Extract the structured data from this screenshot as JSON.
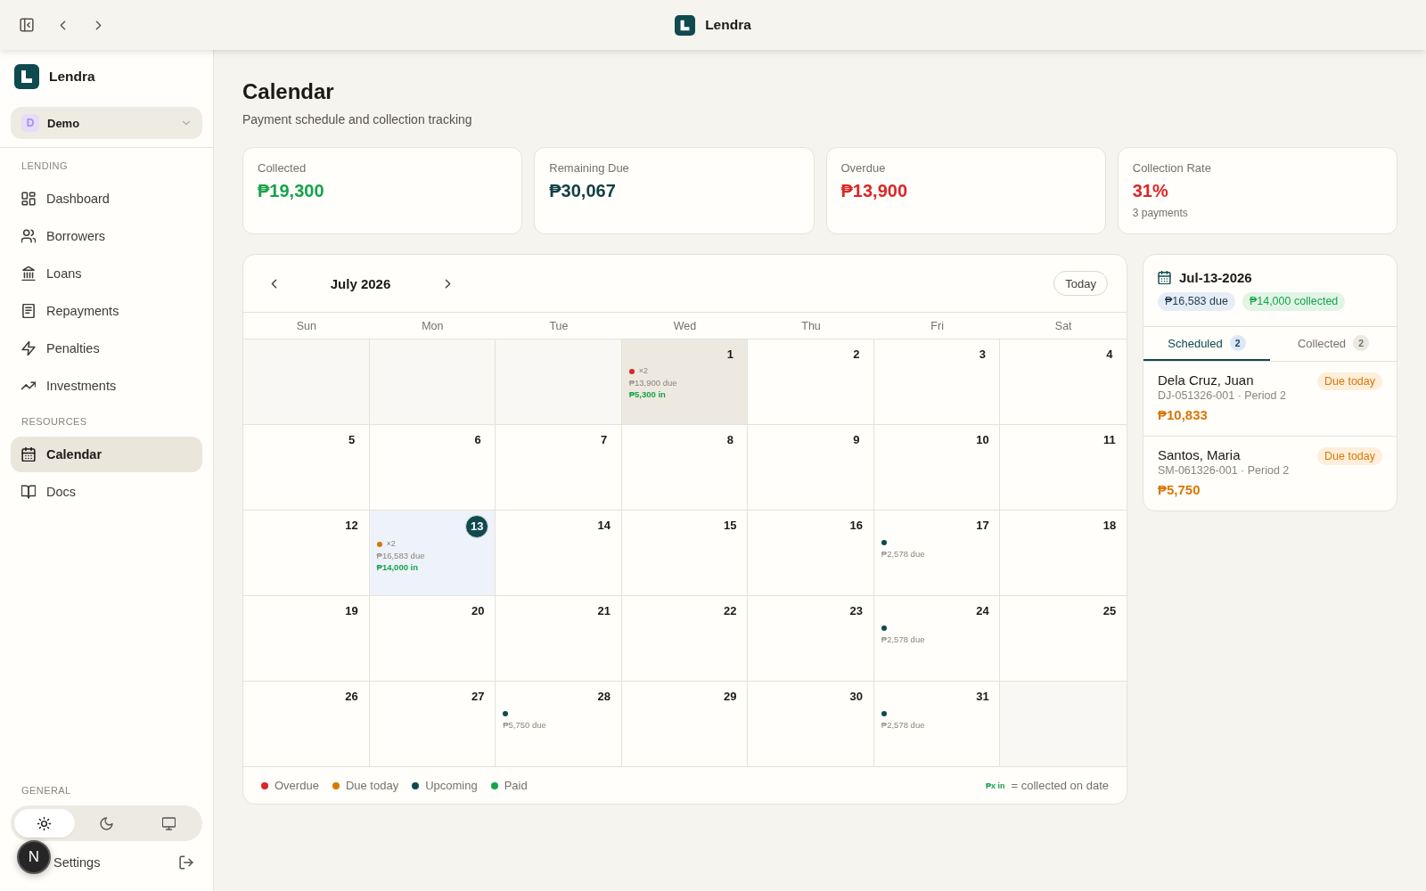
{
  "topbar": {
    "app_name": "Lendra"
  },
  "sidebar": {
    "brand": "Lendra",
    "workspace": {
      "initial": "D",
      "name": "Demo"
    },
    "sections": [
      {
        "title": "LENDING",
        "items": [
          {
            "kind": "dashboard",
            "label": "Dashboard",
            "selected": false
          },
          {
            "kind": "borrowers",
            "label": "Borrowers",
            "selected": false
          },
          {
            "kind": "loans",
            "label": "Loans",
            "selected": false
          },
          {
            "kind": "repayments",
            "label": "Repayments",
            "selected": false
          },
          {
            "kind": "penalties",
            "label": "Penalties",
            "selected": false
          },
          {
            "kind": "investments",
            "label": "Investments",
            "selected": false
          }
        ]
      },
      {
        "title": "RESOURCES",
        "items": [
          {
            "kind": "calendar",
            "label": "Calendar",
            "selected": true
          },
          {
            "kind": "docs",
            "label": "Docs",
            "selected": false
          }
        ]
      }
    ],
    "general": {
      "title": "GENERAL",
      "theme": [
        {
          "kind": "light",
          "selected": true
        },
        {
          "kind": "dark",
          "selected": false
        },
        {
          "kind": "system",
          "selected": false
        }
      ],
      "settings": "Settings"
    }
  },
  "dev_badge": {
    "label": "N"
  },
  "page": {
    "title": "Calendar",
    "subtitle": "Payment schedule and collection tracking"
  },
  "stats": [
    {
      "label": "Collected",
      "value": "₱19,300",
      "color": "#16a34a"
    },
    {
      "label": "Remaining Due",
      "value": "₱30,067",
      "color": "#113f45"
    },
    {
      "label": "Overdue",
      "value": "₱13,900",
      "color": "#dc2626"
    },
    {
      "label": "Collection Rate",
      "value": "31%",
      "color": "#dc2626",
      "note": "3 payments"
    }
  ],
  "calendar": {
    "month": "July 2026",
    "today_button": "Today",
    "weekdays": [
      "Sun",
      "Mon",
      "Tue",
      "Wed",
      "Thu",
      "Fri",
      "Sat"
    ],
    "weeks": [
      [
        {
          "kind": "blank"
        },
        {
          "kind": "blank"
        },
        {
          "kind": "blank"
        },
        {
          "kind": "day",
          "number": "1",
          "selected": false,
          "today": false,
          "highlighted": true,
          "events": {
            "color": "#dc2626",
            "count": "×2",
            "due": "₱13,900 due",
            "collected": "₱5,300 in"
          }
        },
        {
          "kind": "day",
          "number": "2",
          "selected": false,
          "today": false,
          "highlighted": false
        },
        {
          "kind": "day",
          "number": "3",
          "selected": false,
          "today": false,
          "highlighted": false
        },
        {
          "kind": "day",
          "number": "4",
          "selected": false,
          "today": false,
          "highlighted": false
        }
      ],
      [
        {
          "kind": "day",
          "number": "5",
          "selected": false,
          "today": false,
          "highlighted": false
        },
        {
          "kind": "day",
          "number": "6",
          "selected": false,
          "today": false,
          "highlighted": false
        },
        {
          "kind": "day",
          "number": "7",
          "selected": false,
          "today": false,
          "highlighted": false
        },
        {
          "kind": "day",
          "number": "8",
          "selected": false,
          "today": false,
          "highlighted": false
        },
        {
          "kind": "day",
          "number": "9",
          "selected": false,
          "today": false,
          "highlighted": false
        },
        {
          "kind": "day",
          "number": "10",
          "selected": false,
          "today": false,
          "highlighted": false
        },
        {
          "kind": "day",
          "number": "11",
          "selected": false,
          "today": false,
          "highlighted": false
        }
      ],
      [
        {
          "kind": "day",
          "number": "12",
          "selected": false,
          "today": false,
          "highlighted": false
        },
        {
          "kind": "day",
          "number": "13",
          "selected": true,
          "today": true,
          "highlighted": false,
          "events": {
            "color": "#d97706",
            "count": "×2",
            "due": "₱16,583 due",
            "collected": "₱14,000 in"
          }
        },
        {
          "kind": "day",
          "number": "14",
          "selected": false,
          "today": false,
          "highlighted": false
        },
        {
          "kind": "day",
          "number": "15",
          "selected": false,
          "today": false,
          "highlighted": false
        },
        {
          "kind": "day",
          "number": "16",
          "selected": false,
          "today": false,
          "highlighted": false
        },
        {
          "kind": "day",
          "number": "17",
          "selected": false,
          "today": false,
          "highlighted": false,
          "events": {
            "color": "#0f4a4f",
            "due": "₱2,578 due"
          }
        },
        {
          "kind": "day",
          "number": "18",
          "selected": false,
          "today": false,
          "highlighted": false
        }
      ],
      [
        {
          "kind": "day",
          "number": "19",
          "selected": false,
          "today": false,
          "highlighted": false
        },
        {
          "kind": "day",
          "number": "20",
          "selected": false,
          "today": false,
          "highlighted": false
        },
        {
          "kind": "day",
          "number": "21",
          "selected": false,
          "today": false,
          "highlighted": false
        },
        {
          "kind": "day",
          "number": "22",
          "selected": false,
          "today": false,
          "highlighted": false
        },
        {
          "kind": "day",
          "number": "23",
          "selected": false,
          "today": false,
          "highlighted": false
        },
        {
          "kind": "day",
          "number": "24",
          "selected": false,
          "today": false,
          "highlighted": false,
          "events": {
            "color": "#0f4a4f",
            "due": "₱2,578 due"
          }
        },
        {
          "kind": "day",
          "number": "25",
          "selected": false,
          "today": false,
          "highlighted": false
        }
      ],
      [
        {
          "kind": "day",
          "number": "26",
          "selected": false,
          "today": false,
          "highlighted": false
        },
        {
          "kind": "day",
          "number": "27",
          "selected": false,
          "today": false,
          "highlighted": false
        },
        {
          "kind": "day",
          "number": "28",
          "selected": false,
          "today": false,
          "highlighted": false,
          "events": {
            "color": "#0f4a4f",
            "due": "₱5,750 due"
          }
        },
        {
          "kind": "day",
          "number": "29",
          "selected": false,
          "today": false,
          "highlighted": false
        },
        {
          "kind": "day",
          "number": "30",
          "selected": false,
          "today": false,
          "highlighted": false
        },
        {
          "kind": "day",
          "number": "31",
          "selected": false,
          "today": false,
          "highlighted": false,
          "events": {
            "color": "#0f4a4f",
            "due": "₱2,578 due"
          }
        },
        {
          "kind": "blank"
        }
      ]
    ],
    "legend": [
      {
        "label": "Overdue",
        "color": "#dc2626"
      },
      {
        "label": "Due today",
        "color": "#d97706"
      },
      {
        "label": "Upcoming",
        "color": "#0f4a4f"
      },
      {
        "label": "Paid",
        "color": "#16a34a"
      }
    ],
    "legend_note": {
      "sample": "₱x in",
      "text": "= collected on date"
    }
  },
  "day_panel": {
    "date": "Jul-13-2026",
    "due": "₱16,583 due",
    "collected": "₱14,000 collected",
    "tabs": [
      {
        "label": "Scheduled",
        "count": "2",
        "selected": true
      },
      {
        "label": "Collected",
        "count": "2",
        "selected": false
      }
    ],
    "payments": [
      {
        "name": "Dela Cruz, Juan",
        "ref": "DJ-051326-001 · Period 2",
        "amount": "₱10,833",
        "status": "Due today"
      },
      {
        "name": "Santos, Maria",
        "ref": "SM-061326-001 · Period 2",
        "amount": "₱5,750",
        "status": "Due today"
      }
    ]
  }
}
